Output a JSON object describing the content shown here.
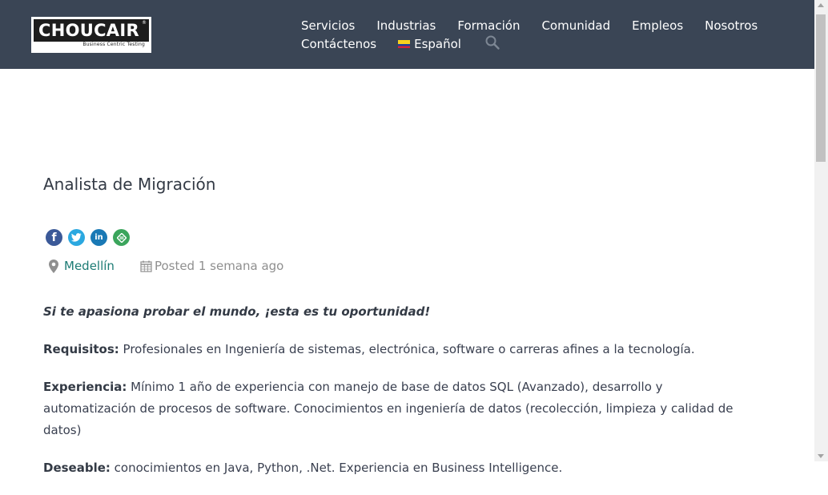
{
  "header": {
    "logo_text": "CHOUCAIR",
    "logo_tagline": "Business Centric Testing",
    "nav_row1": [
      "Servicios",
      "Industrias",
      "Formación",
      "Comunidad",
      "Empleos",
      "Nosotros"
    ],
    "nav_row2": {
      "contact": "Contáctenos",
      "language": "Español"
    },
    "icons": {
      "search": "search-icon",
      "flag": "colombia-flag-icon"
    }
  },
  "job": {
    "title": "Analista de Migración",
    "share_icons": [
      "facebook-icon",
      "twitter-icon",
      "linkedin-icon",
      "more-share-icon"
    ],
    "location": "Medellín",
    "posted": "Posted 1 semana ago"
  },
  "content": {
    "intro": "Si te apasiona probar el mundo, ¡esta es tu oportunidad!",
    "requisitos_label": "Requisitos:",
    "requisitos_text": " Profesionales en Ingeniería de sistemas, electrónica, software o carreras afines a la tecnología.",
    "experiencia_label": "Experiencia:",
    "experiencia_text": " Mínimo 1 año de experiencia con manejo de base de datos SQL (Avanzado), desarrollo y automatización de procesos de software. Conocimientos en ingeniería de datos (recolección, limpieza y calidad de datos)",
    "deseable_label": "Deseable:",
    "deseable_text": " conocimientos en Java, Python, .Net. Experiencia en Business Intelligence."
  },
  "colors": {
    "header_bg": "#3a4555",
    "link_green": "#1c7b74",
    "text": "#333a45"
  }
}
